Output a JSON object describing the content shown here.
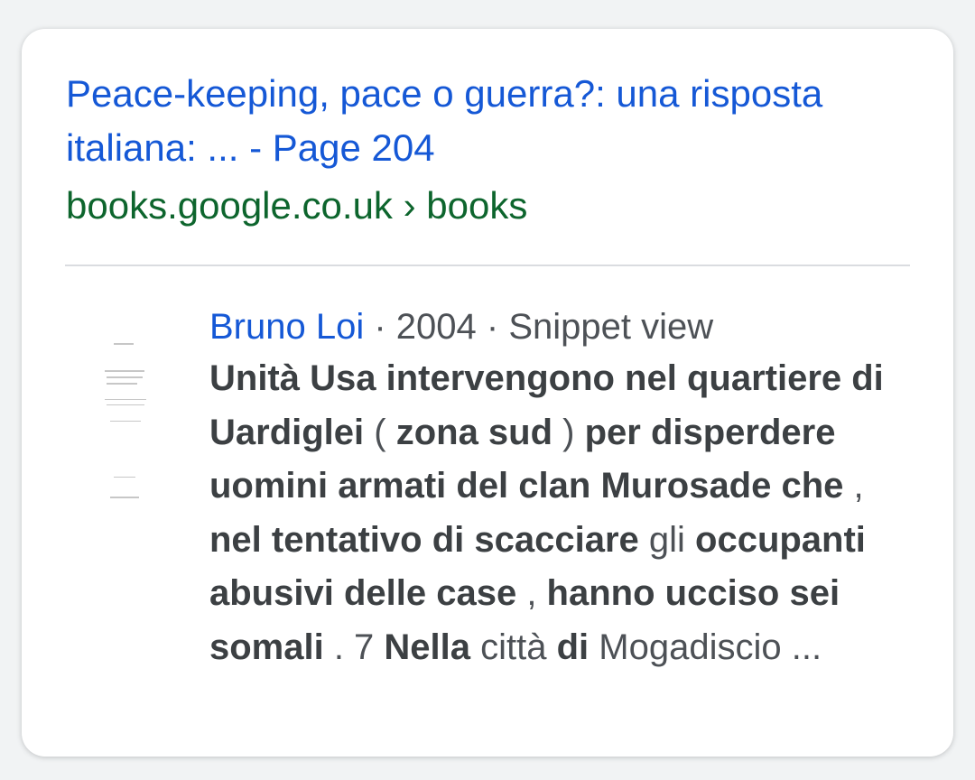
{
  "result": {
    "title": "Peace-keeping, pace o guerra?: una risposta italiana: ... - Page 204",
    "breadcrumb": "books.google.co.uk › books",
    "author": "Bruno Loi",
    "sep1": " · ",
    "year": "2004",
    "sep2": " · ",
    "view_type": "Snippet view",
    "snippet": [
      {
        "t": "Unità Usa intervengono nel quartiere di Uardiglei",
        "b": true
      },
      {
        "t": " ( ",
        "b": false
      },
      {
        "t": "zona sud",
        "b": true
      },
      {
        "t": " ) ",
        "b": false
      },
      {
        "t": "per disperdere uomini armati del clan Murosade che",
        "b": true
      },
      {
        "t": " , ",
        "b": false
      },
      {
        "t": "nel tentativo di scacciare",
        "b": true
      },
      {
        "t": " gli ",
        "b": false
      },
      {
        "t": "occupanti abusivi delle case",
        "b": true
      },
      {
        "t": " , ",
        "b": false
      },
      {
        "t": "hanno ucciso sei somali",
        "b": true
      },
      {
        "t": " . 7 ",
        "b": false
      },
      {
        "t": "Nella",
        "b": true
      },
      {
        "t": " città ",
        "b": false
      },
      {
        "t": "di",
        "b": true
      },
      {
        "t": " Mogadiscio ...",
        "b": false
      }
    ]
  },
  "colors": {
    "link": "#1558d6",
    "url": "#0d652d",
    "text": "#4d5156",
    "bold_text": "#3c4043",
    "divider": "#dadce0"
  },
  "icons": {
    "thumbnail": "book-cover-thumbnail"
  }
}
